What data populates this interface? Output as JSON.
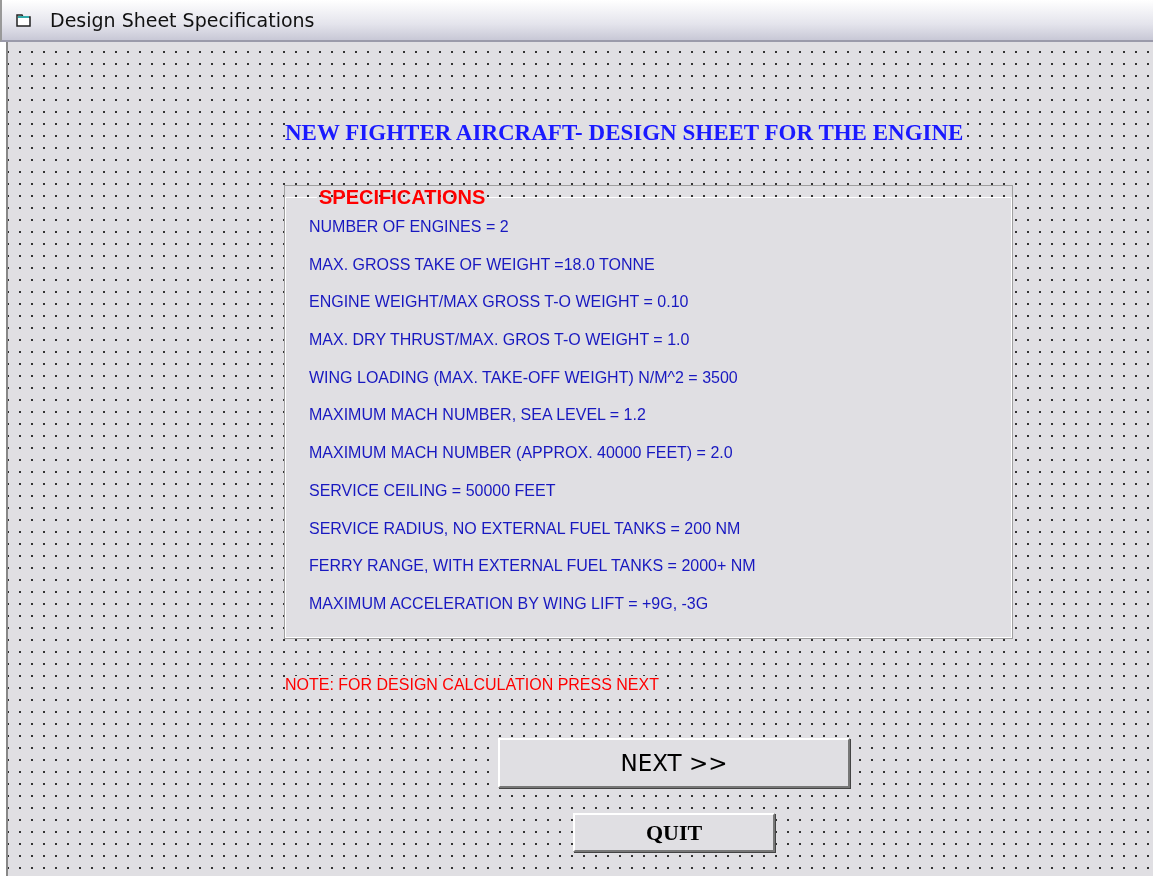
{
  "window": {
    "title": "Design Sheet Specifications"
  },
  "heading": "NEW FIGHTER AIRCRAFT- DESIGN SHEET FOR THE ENGINE",
  "specifications": {
    "title": "SPECIFICATIONS",
    "items": [
      "NUMBER OF ENGINES = 2",
      "MAX. GROSS TAKE OF WEIGHT =18.0 TONNE",
      "ENGINE WEIGHT/MAX GROSS T-O WEIGHT = 0.10",
      "MAX. DRY THRUST/MAX. GROS T-O WEIGHT = 1.0",
      "WING LOADING (MAX. TAKE-OFF WEIGHT) N/M^2 = 3500",
      "MAXIMUM MACH NUMBER, SEA LEVEL = 1.2",
      "MAXIMUM MACH NUMBER (APPROX. 40000 FEET)  = 2.0",
      "SERVICE CEILING = 50000 FEET",
      "SERVICE RADIUS, NO EXTERNAL FUEL TANKS = 200 NM",
      "FERRY RANGE, WITH EXTERNAL FUEL TANKS = 2000+ NM",
      "MAXIMUM ACCELERATION BY WING LIFT = +9G, -3G"
    ]
  },
  "note": "NOTE: FOR DESIGN CALCULATION PRESS NEXT",
  "buttons": [
    {
      "kind": "next",
      "label": "NEXT >>"
    },
    {
      "kind": "quit",
      "label": "QUIT"
    }
  ]
}
